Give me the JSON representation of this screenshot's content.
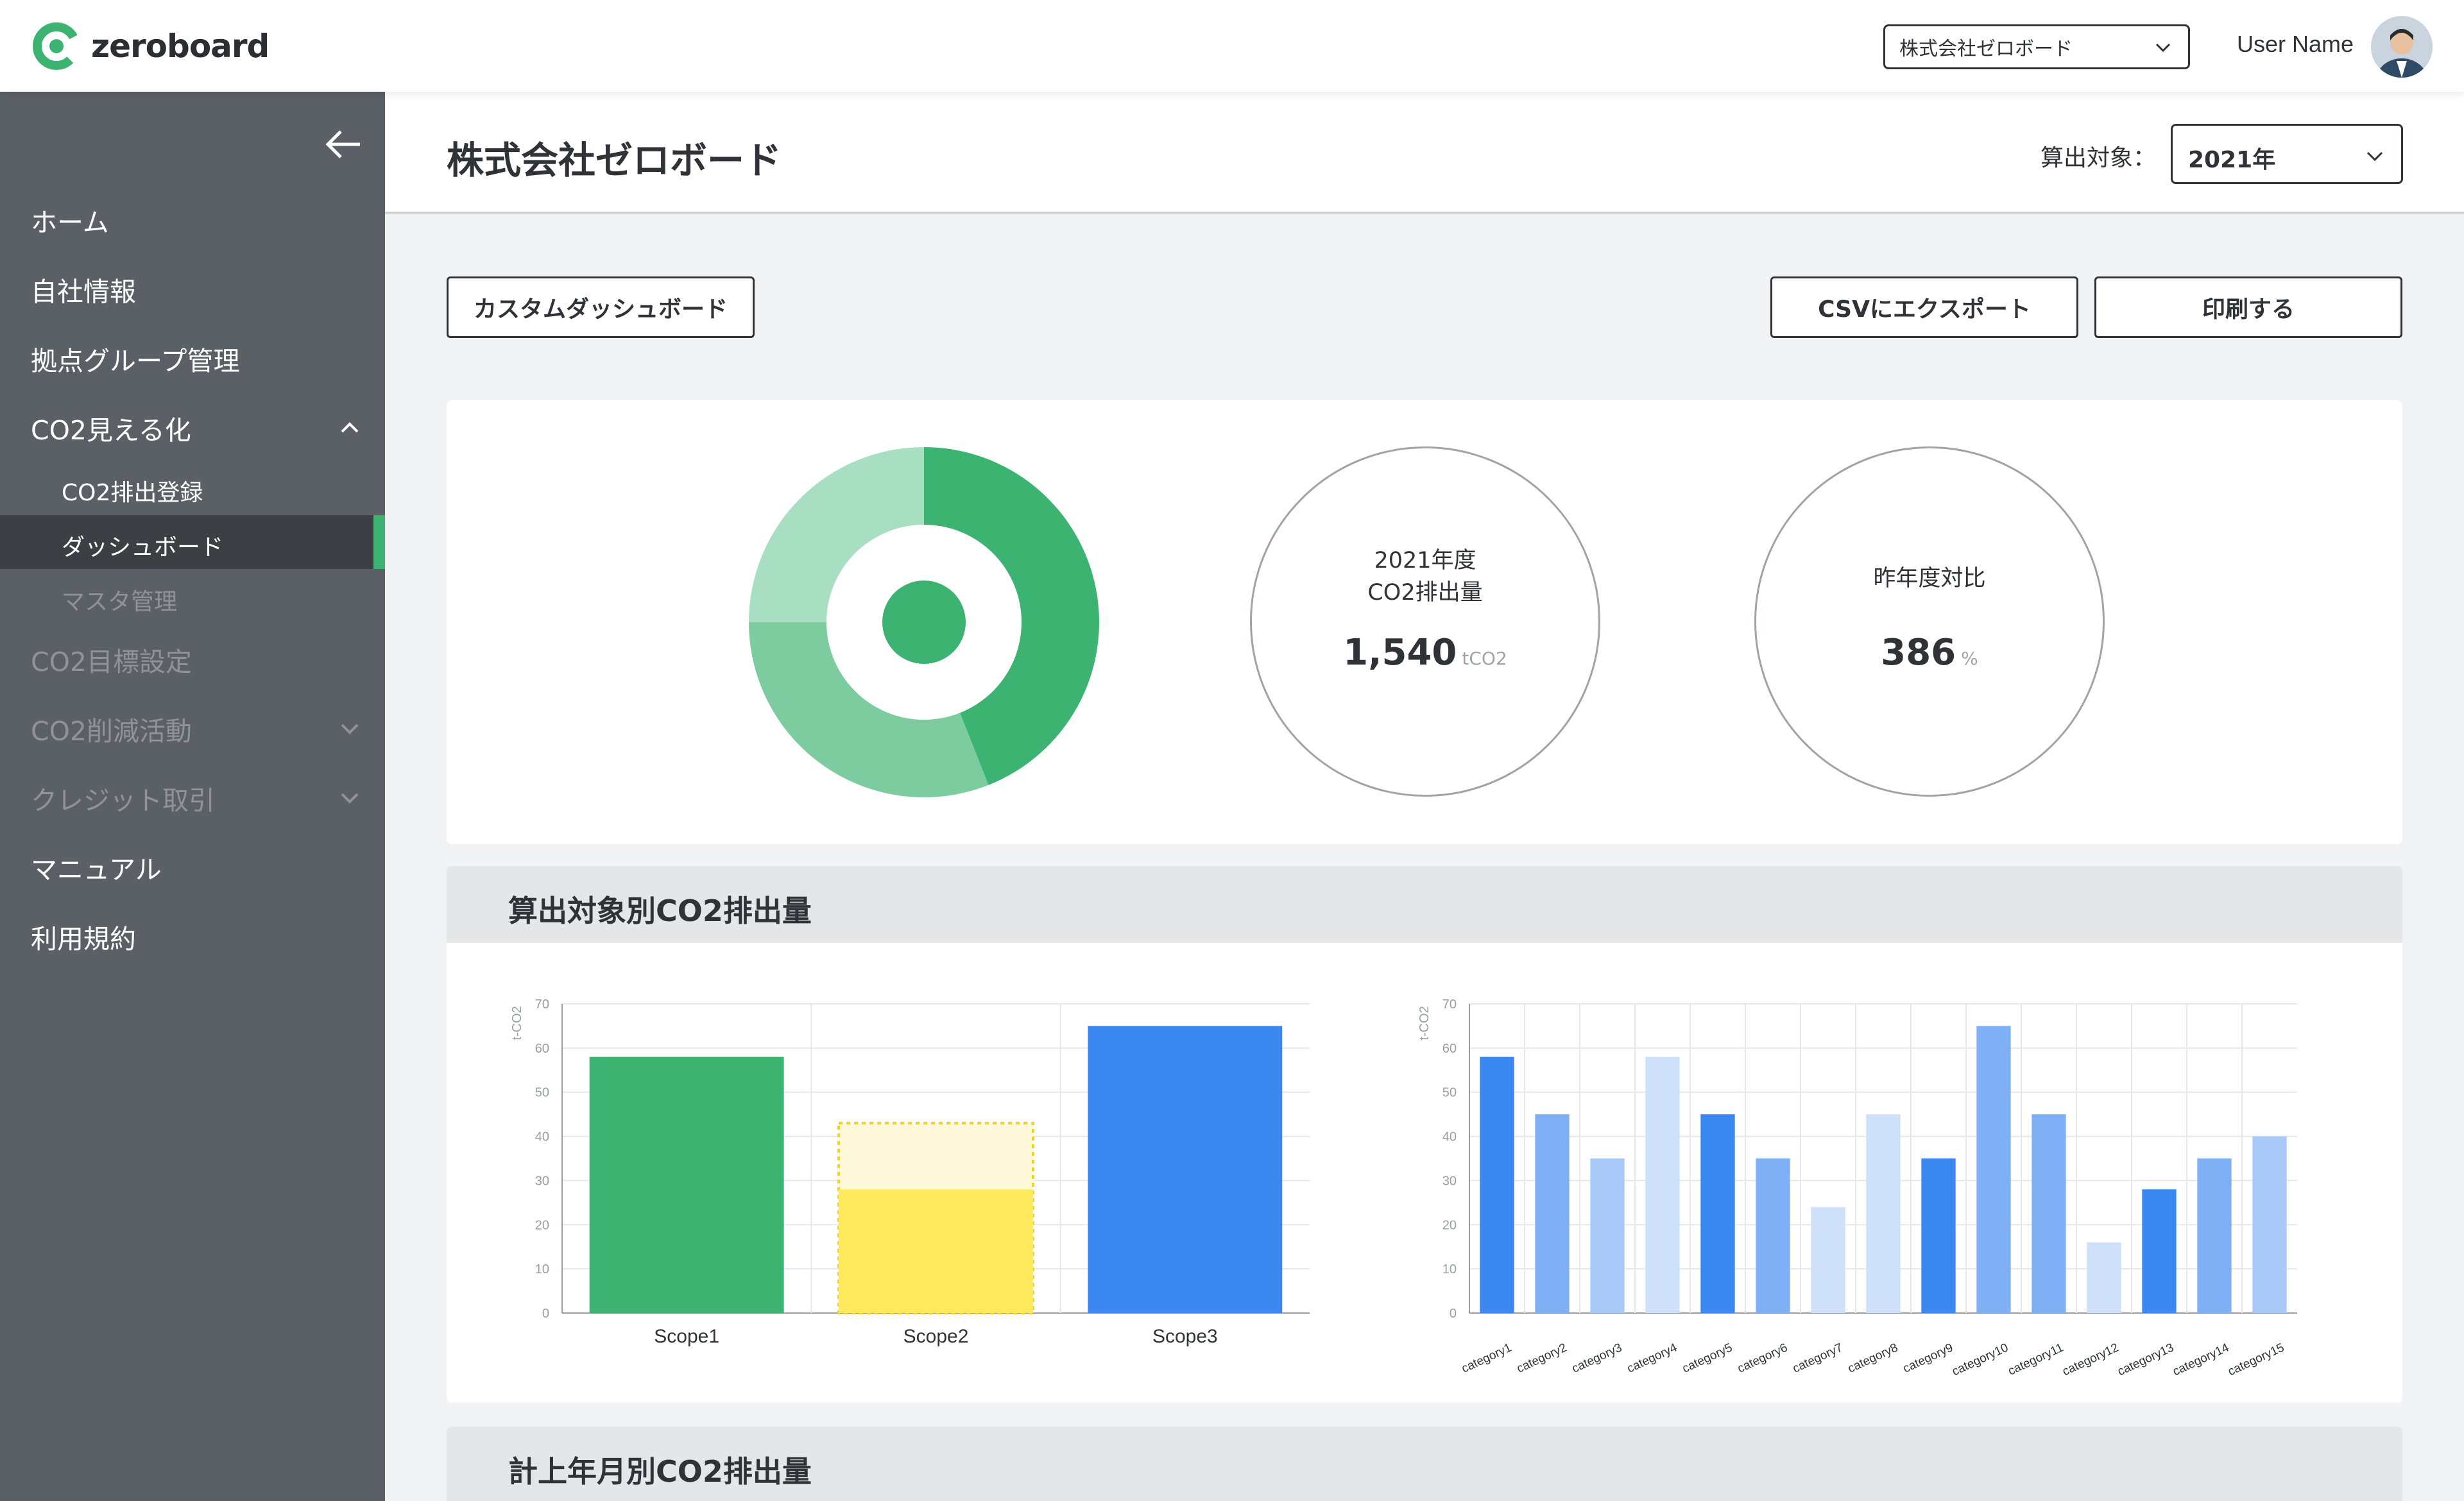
{
  "header": {
    "logo_text": "zeroboard",
    "company_select": "株式会社ゼロボード",
    "user_name": "User Name"
  },
  "sidebar": {
    "items": [
      {
        "label": "ホーム",
        "enabled": true
      },
      {
        "label": "自社情報",
        "enabled": true
      },
      {
        "label": "拠点グループ管理",
        "enabled": true
      },
      {
        "label": "CO2見える化",
        "enabled": true,
        "expanded": true,
        "children": [
          {
            "label": "CO2排出登録",
            "enabled": true
          },
          {
            "label": "ダッシュボード",
            "enabled": true,
            "active": true
          },
          {
            "label": "マスタ管理",
            "enabled": false
          }
        ]
      },
      {
        "label": "CO2目標設定",
        "enabled": false
      },
      {
        "label": "CO2削減活動",
        "enabled": false
      },
      {
        "label": "クレジット取引",
        "enabled": false
      },
      {
        "label": "マニュアル",
        "enabled": true
      },
      {
        "label": "利用規約",
        "enabled": true
      }
    ]
  },
  "page": {
    "title": "株式会社ゼロボード",
    "target_label": "算出対象：",
    "year": "2021年"
  },
  "buttons": {
    "custom_dashboard": "カスタムダッシュボード",
    "csv_export": "CSVにエクスポート",
    "print": "印刷する"
  },
  "summary": {
    "emission_caption_line1": "2021年度",
    "emission_caption_line2": "CO2排出量",
    "emission_value": "1,540",
    "emission_unit": "tCO2",
    "yoy_caption": "昨年度対比",
    "yoy_value": "386",
    "yoy_unit": "%"
  },
  "sections": {
    "by_target": "算出対象別CO2排出量",
    "by_month": "計上年月別CO2排出量"
  },
  "colors": {
    "accent_green": "#3cb371",
    "scope_green": "#3cb371",
    "scope_yellow": "#ffe95c",
    "scope_blue": "#3b88f0",
    "sidebar_bg": "#5b6066"
  },
  "chart_data": [
    {
      "type": "pie",
      "values": [
        44,
        31,
        25
      ],
      "colors": [
        "#3cb371",
        "#7dcca0",
        "#a8dfc2"
      ]
    },
    {
      "type": "bar",
      "ylabel": "t-CO2",
      "ylim": [
        0,
        70
      ],
      "yticks": [
        0,
        10,
        20,
        30,
        40,
        50,
        60,
        70
      ],
      "categories": [
        "Scope1",
        "Scope2",
        "Scope3"
      ],
      "values": [
        58,
        28,
        65
      ],
      "scope2_dotted_extent": 43,
      "grid": true
    },
    {
      "type": "bar",
      "ylabel": "t-CO2",
      "ylim": [
        0,
        70
      ],
      "yticks": [
        0,
        10,
        20,
        30,
        40,
        50,
        60,
        70
      ],
      "categories": [
        "category1",
        "category2",
        "category3",
        "category4",
        "category5",
        "category6",
        "category7",
        "category8",
        "category9",
        "category10",
        "category11",
        "category12",
        "category13",
        "category14",
        "category15"
      ],
      "values": [
        58,
        45,
        35,
        58,
        45,
        35,
        24,
        45,
        35,
        65,
        45,
        16,
        28,
        35,
        40
      ],
      "shades": [
        0,
        1,
        2,
        3,
        0,
        1,
        3,
        3,
        0,
        1,
        1,
        3,
        0,
        1,
        2
      ],
      "grid": true
    }
  ]
}
